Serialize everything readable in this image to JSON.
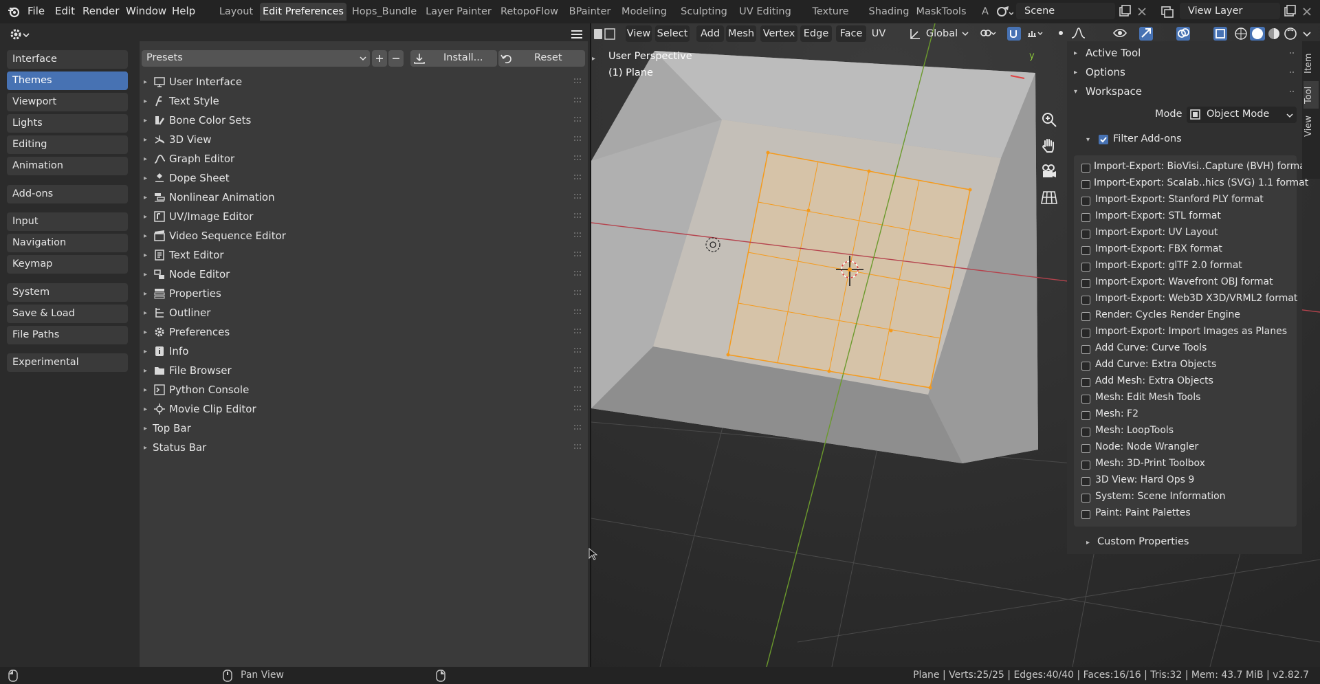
{
  "topbar": {
    "menus": [
      "File",
      "Edit",
      "Render",
      "Window",
      "Help"
    ],
    "workspaces": [
      "Layout",
      "Edit Preferences",
      "Hops_Bundle",
      "Layer Painter",
      "RetopoFlow",
      "BPainter",
      "Modeling",
      "Sculpting",
      "UV Editing",
      "Texture Paint",
      "Shading",
      "MaskTools",
      "A"
    ],
    "active_workspace": "Edit Preferences",
    "scene_name": "Scene",
    "view_layer": "View Layer"
  },
  "prefs": {
    "nav_groups": [
      [
        "Interface",
        "Themes",
        "Viewport",
        "Lights",
        "Editing",
        "Animation"
      ],
      [
        "Add-ons"
      ],
      [
        "Input",
        "Navigation",
        "Keymap"
      ],
      [
        "System",
        "Save & Load",
        "File Paths"
      ],
      [
        "Experimental"
      ]
    ],
    "active_nav": "Themes",
    "presets_label": "Presets",
    "install_label": "Install...",
    "reset_label": "Reset",
    "theme_sections": [
      {
        "label": "User Interface",
        "icon": "user-interface-icon"
      },
      {
        "label": "Text Style",
        "icon": "text-style-icon"
      },
      {
        "label": "Bone Color Sets",
        "icon": "bone-icon"
      },
      {
        "label": "3D View",
        "icon": "3d-view-icon"
      },
      {
        "label": "Graph Editor",
        "icon": "graph-editor-icon"
      },
      {
        "label": "Dope Sheet",
        "icon": "dope-sheet-icon"
      },
      {
        "label": "Nonlinear Animation",
        "icon": "nla-icon"
      },
      {
        "label": "UV/Image Editor",
        "icon": "image-editor-icon"
      },
      {
        "label": "Video Sequence Editor",
        "icon": "sequencer-icon"
      },
      {
        "label": "Text Editor",
        "icon": "text-editor-icon"
      },
      {
        "label": "Node Editor",
        "icon": "node-editor-icon"
      },
      {
        "label": "Properties",
        "icon": "properties-icon"
      },
      {
        "label": "Outliner",
        "icon": "outliner-icon"
      },
      {
        "label": "Preferences",
        "icon": "preferences-gear-icon"
      },
      {
        "label": "Info",
        "icon": "info-icon"
      },
      {
        "label": "File Browser",
        "icon": "folder-icon"
      },
      {
        "label": "Python Console",
        "icon": "console-icon"
      },
      {
        "label": "Movie Clip Editor",
        "icon": "movie-clip-icon"
      },
      {
        "label": "Top Bar",
        "icon": ""
      },
      {
        "label": "Status Bar",
        "icon": ""
      }
    ]
  },
  "viewport": {
    "menus": [
      "View",
      "Select",
      "Add",
      "Mesh",
      "Vertex",
      "Edge",
      "Face",
      "UV"
    ],
    "transform_orientation": "Global",
    "perspective_label": "User Perspective",
    "object_label": "(1) Plane",
    "axis_y": "y"
  },
  "npanel": {
    "active_tool": "Active Tool",
    "options": "Options",
    "workspace": "Workspace",
    "mode_label": "Mode",
    "mode_value": "Object Mode",
    "filter_addons": "Filter Add-ons",
    "filter_checked": true,
    "addons": [
      "Import-Export: BioVisi..Capture (BVH) format",
      "Import-Export: Scalab..hics (SVG) 1.1 format",
      "Import-Export: Stanford PLY format",
      "Import-Export: STL format",
      "Import-Export: UV Layout",
      "Import-Export: FBX format",
      "Import-Export: glTF 2.0 format",
      "Import-Export: Wavefront OBJ format",
      "Import-Export: Web3D X3D/VRML2 format",
      "Render: Cycles Render Engine",
      "Import-Export: Import Images as Planes",
      "Add Curve: Curve Tools",
      "Add Curve: Extra Objects",
      "Add Mesh: Extra Objects",
      "Mesh: Edit Mesh Tools",
      "Mesh: F2",
      "Mesh: LoopTools",
      "Node: Node Wrangler",
      "Mesh: 3D-Print Toolbox",
      "3D View: Hard Ops 9",
      "System: Scene Information",
      "Paint: Paint Palettes"
    ],
    "custom_properties": "Custom Properties",
    "side_tabs": [
      "Item",
      "Tool",
      "View"
    ]
  },
  "statusbar": {
    "pan_view": "Pan View",
    "stats": "Plane | Verts:25/25 | Edges:40/40 | Faces:16/16 | Tris:32 | Mem: 43.7 MiB | v2.82.7"
  }
}
